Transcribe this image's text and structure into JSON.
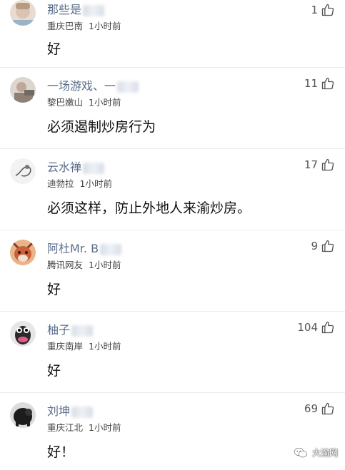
{
  "comments": [
    {
      "name": "那些是",
      "location": "重庆巴南",
      "time": "1小时前",
      "text": "好",
      "likes": "1",
      "avatar_color": "#d9c4b3"
    },
    {
      "name": "一场游戏、一",
      "location": "黎巴嫩山",
      "time": "1小时前",
      "text": "必须遏制炒房行为",
      "likes": "11",
      "avatar_color": "#cfc4bc"
    },
    {
      "name": "云水禅",
      "location": "迪勃拉",
      "time": "1小时前",
      "text": "必须这样，防止外地人来渝炒房。",
      "likes": "17",
      "avatar_color": "#e6e6e6"
    },
    {
      "name": "阿杜Mr. B",
      "location": "腾讯网友",
      "time": "1小时前",
      "text": "好",
      "likes": "9",
      "avatar_color": "#c8603a"
    },
    {
      "name": "柚子",
      "location": "重庆南岸",
      "time": "1小时前",
      "text": "好",
      "likes": "104",
      "avatar_color": "#2a2a2a"
    },
    {
      "name": "刘坤",
      "location": "重庆江北",
      "time": "1小时前",
      "text": "好！",
      "likes": "69",
      "avatar_color": "#1c1c1c"
    }
  ],
  "watermark": {
    "text": "大渝网"
  },
  "icons": {
    "like": "thumbs-up-icon"
  }
}
